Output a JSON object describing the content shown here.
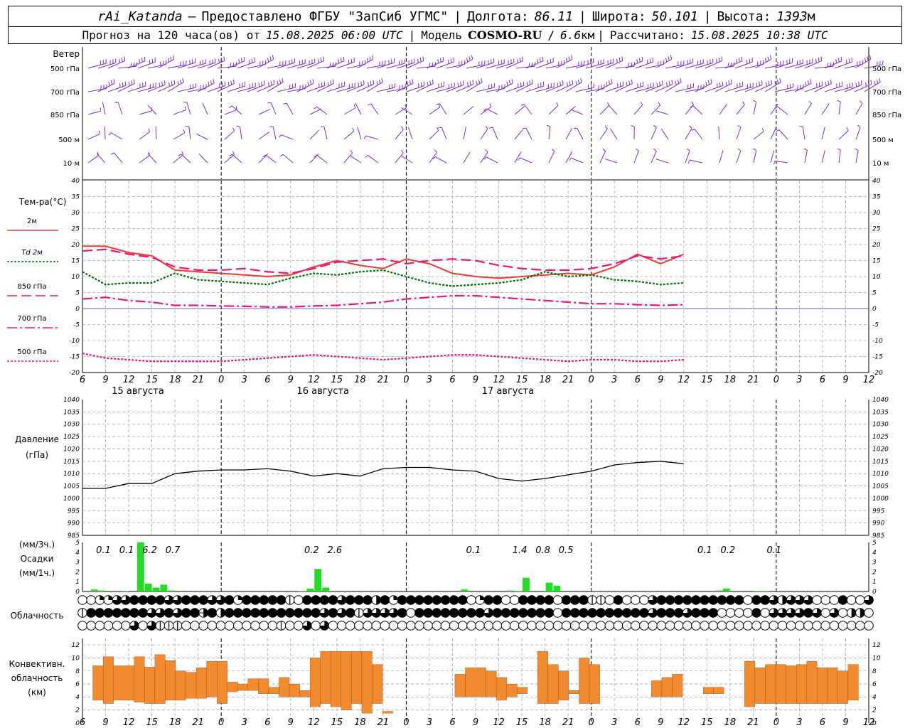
{
  "header": {
    "line1": {
      "station": "rAi_Katanda",
      "dash": "—",
      "provider": "Предоставлено ФГБУ \"ЗапСиб УГМС\"",
      "lon_label": "Долгота:",
      "lon_value": "86.11",
      "lat_label": "Широта:",
      "lat_value": "50.101",
      "alt_label": "Высота:",
      "alt_value": "1393",
      "alt_unit": "м"
    },
    "line2": {
      "forecast_label": "Прогноз на 120 часа(ов) от",
      "forecast_time": "15.08.2025 06:00 UTC",
      "model_label": "Модель",
      "model_name": "COSMO-RU",
      "model_res": "6.6",
      "model_res_unit": "км",
      "calc_label": "Рассчитано:",
      "calc_time": "15.08.2025 10:38 UTC"
    }
  },
  "chart_data": [
    {
      "type": "line",
      "panel": "wind",
      "title": "Ветер",
      "levels": [
        "500 гПа",
        "700 гПа",
        "850 гПа",
        "500 м",
        "10 м"
      ],
      "colors": {
        "barb": "#7b2fd0"
      }
    },
    {
      "type": "line",
      "panel": "temperature",
      "title": "Тем-ра(°C)",
      "ylim": [
        -20,
        40
      ],
      "yticks": [
        40,
        35,
        30,
        25,
        20,
        15,
        10,
        5,
        0,
        -5,
        -10,
        -15,
        -20
      ],
      "x_hours": [
        0,
        3,
        6,
        9,
        12,
        15,
        18,
        21,
        24,
        27,
        30,
        33,
        36,
        39,
        42,
        45,
        48,
        51,
        54,
        57,
        60,
        63,
        66,
        69,
        72,
        75,
        78
      ],
      "xtick_labels": [
        "6",
        "9",
        "12",
        "15",
        "18",
        "21",
        "0",
        "3",
        "6",
        "9",
        "12",
        "15",
        "18",
        "21",
        "0",
        "3",
        "6",
        "9",
        "12",
        "15",
        "18",
        "21",
        "0",
        "3",
        "6",
        "9",
        "12"
      ],
      "day_labels": [
        "15 августа",
        "16 августа",
        "17 августа"
      ],
      "series": [
        {
          "name": "2м",
          "color": "#ef3b2c",
          "dash": "solid",
          "values": [
            19.5,
            19.5,
            17.5,
            16.5,
            12.0,
            11.5,
            11.0,
            10.5,
            10.0,
            10.5,
            13.0,
            15.0,
            13.5,
            12.5,
            15.5,
            14.0,
            11.0,
            10.0,
            9.5,
            10.0,
            10.5,
            11.0,
            10.5,
            13.0,
            17.0,
            14.0,
            17.0
          ]
        },
        {
          "name": "Td 2м",
          "color": "#007000",
          "dash": "dot",
          "values": [
            11.5,
            7.5,
            8.0,
            8.0,
            11.0,
            9.0,
            8.5,
            8.0,
            7.5,
            9.5,
            11.0,
            10.5,
            11.5,
            12.0,
            10.0,
            8.0,
            7.0,
            7.5,
            8.0,
            9.0,
            11.5,
            10.0,
            10.5,
            9.0,
            8.5,
            7.5,
            8.0
          ]
        },
        {
          "name": "850 гПа",
          "color": "#e8177b",
          "dash": "longdash",
          "values": [
            18.0,
            18.5,
            17.0,
            16.0,
            13.0,
            12.0,
            12.0,
            12.5,
            11.5,
            11.0,
            12.5,
            14.5,
            15.0,
            15.5,
            14.0,
            15.0,
            15.5,
            15.0,
            13.5,
            12.5,
            12.0,
            12.0,
            12.5,
            14.0,
            16.5,
            15.5,
            16.5
          ]
        },
        {
          "name": "700 гПа",
          "color": "#e8177b",
          "dash": "dashdot",
          "values": [
            3.0,
            3.5,
            2.5,
            2.0,
            1.0,
            1.0,
            0.8,
            0.7,
            0.5,
            0.5,
            0.8,
            1.0,
            1.5,
            2.0,
            3.0,
            3.5,
            4.0,
            4.0,
            3.5,
            3.0,
            2.5,
            2.0,
            1.5,
            1.5,
            1.2,
            1.0,
            1.2
          ]
        },
        {
          "name": "500 гПа",
          "color": "#e8177b",
          "dash": "dot",
          "values": [
            -14.0,
            -15.5,
            -16.0,
            -16.5,
            -16.5,
            -16.5,
            -16.5,
            -16.0,
            -15.5,
            -15.0,
            -14.5,
            -15.0,
            -15.5,
            -16.0,
            -15.5,
            -15.0,
            -14.5,
            -14.5,
            -15.0,
            -15.5,
            -16.0,
            -16.5,
            -16.0,
            -16.0,
            -16.5,
            -16.5,
            -16.0
          ]
        }
      ]
    },
    {
      "type": "line",
      "panel": "pressure",
      "title": "Давление",
      "unit": "(гПа)",
      "ylim": [
        985,
        1040
      ],
      "yticks": [
        1040,
        1035,
        1030,
        1025,
        1020,
        1015,
        1010,
        1005,
        1000,
        995,
        990,
        985
      ],
      "series": [
        {
          "name": "Давление",
          "color": "#000000",
          "values": [
            1004.0,
            1004.0,
            1006.0,
            1006.0,
            1010.0,
            1011.0,
            1011.5,
            1011.5,
            1012.0,
            1011.0,
            1009.0,
            1010.0,
            1009.0,
            1012.0,
            1012.5,
            1012.5,
            1011.5,
            1011.0,
            1008.0,
            1007.0,
            1008.0,
            1009.5,
            1011.0,
            1013.5,
            1014.5,
            1015.0,
            1014.0
          ]
        }
      ]
    },
    {
      "type": "bar",
      "panel": "precipitation",
      "title": "Осадки",
      "labels": [
        "(мм/3ч.)",
        "(мм/1ч.)"
      ],
      "ylim": [
        0,
        5
      ],
      "yticks": [
        5,
        4,
        3,
        2,
        1,
        0
      ],
      "color": "#22dd22",
      "totals_3h": [
        {
          "hour": 3,
          "text": "0.1"
        },
        {
          "hour": 6,
          "text": "0.1"
        },
        {
          "hour": 9,
          "text": "6.2"
        },
        {
          "hour": 12,
          "text": "0.7"
        },
        {
          "hour": 30,
          "text": "0.2"
        },
        {
          "hour": 33,
          "text": "2.6"
        },
        {
          "hour": 51,
          "text": "0.1"
        },
        {
          "hour": 57,
          "text": "1.4"
        },
        {
          "hour": 60,
          "text": "0.8"
        },
        {
          "hour": 63,
          "text": "0.5"
        },
        {
          "hour": 81,
          "text": "0.1"
        },
        {
          "hour": 84,
          "text": "0.2"
        },
        {
          "hour": 90,
          "text": "0.1"
        }
      ],
      "bars_1h": [
        {
          "hour": 1,
          "value": 0.2
        },
        {
          "hour": 2,
          "value": 0.1
        },
        {
          "hour": 5,
          "value": 0.05
        },
        {
          "hour": 7,
          "value": 5.0
        },
        {
          "hour": 8,
          "value": 0.8
        },
        {
          "hour": 9,
          "value": 0.4
        },
        {
          "hour": 10,
          "value": 0.7
        },
        {
          "hour": 11,
          "value": 0.1
        },
        {
          "hour": 28,
          "value": 0.05
        },
        {
          "hour": 29,
          "value": 0.3
        },
        {
          "hour": 30,
          "value": 2.3
        },
        {
          "hour": 31,
          "value": 0.4
        },
        {
          "hour": 49,
          "value": 0.2
        },
        {
          "hour": 55,
          "value": 0.1
        },
        {
          "hour": 56,
          "value": 0.05
        },
        {
          "hour": 57,
          "value": 1.4
        },
        {
          "hour": 60,
          "value": 0.9
        },
        {
          "hour": 61,
          "value": 0.6
        },
        {
          "hour": 82,
          "value": 0.1
        },
        {
          "hour": 83,
          "value": 0.3
        },
        {
          "hour": 87,
          "value": 0.05
        },
        {
          "hour": 88,
          "value": 0.05
        }
      ]
    },
    {
      "type": "heatmap",
      "panel": "cloudiness",
      "title": "Облачность",
      "rows": [
        "00dd33444433444334d44444104444344424d444444440d4400444404441104000344444444440443233300040034440311000342444444",
        "14444444334344b42444444444443434133334044444444344444440444444444434443444000040333343030220444444444444444444",
        "000000303111000000000001003030000000000000000000000000000000000000000000000000000000000000000000000000300000"
      ]
    },
    {
      "type": "bar",
      "panel": "convective",
      "title": "Конвективн. облачность",
      "labels": [
        "Конвективн.",
        "облачность",
        "(км)"
      ],
      "ylim": [
        0,
        13
      ],
      "yticks": [
        12,
        10,
        8,
        6,
        4,
        2,
        0
      ],
      "color": "#f28a30",
      "bars": [
        {
          "h0": 1,
          "h1": 2,
          "base": 3.5,
          "top": 8.8
        },
        {
          "h0": 2,
          "h1": 3,
          "base": 3.0,
          "top": 10.2
        },
        {
          "h0": 3,
          "h1": 5,
          "base": 3.5,
          "top": 8.8
        },
        {
          "h0": 5,
          "h1": 6,
          "base": 3.2,
          "top": 10.2
        },
        {
          "h0": 6,
          "h1": 7,
          "base": 3.0,
          "top": 8.6
        },
        {
          "h0": 7,
          "h1": 8,
          "base": 3.0,
          "top": 10.5
        },
        {
          "h0": 8,
          "h1": 9,
          "base": 3.5,
          "top": 9.6
        },
        {
          "h0": 9,
          "h1": 10,
          "base": 3.5,
          "top": 8.0
        },
        {
          "h0": 10,
          "h1": 11,
          "base": 3.8,
          "top": 7.8
        },
        {
          "h0": 11,
          "h1": 12,
          "base": 3.8,
          "top": 8.5
        },
        {
          "h0": 12,
          "h1": 13,
          "base": 4.0,
          "top": 9.5
        },
        {
          "h0": 13,
          "h1": 14,
          "base": 3.0,
          "top": 9.5
        },
        {
          "h0": 14,
          "h1": 15,
          "base": 4.8,
          "top": 6.3
        },
        {
          "h0": 15,
          "h1": 16,
          "base": 5.0,
          "top": 6.0
        },
        {
          "h0": 16,
          "h1": 17,
          "base": 5.0,
          "top": 6.8
        },
        {
          "h0": 17,
          "h1": 18,
          "base": 4.5,
          "top": 6.8
        },
        {
          "h0": 18,
          "h1": 19,
          "base": 4.5,
          "top": 5.5
        },
        {
          "h0": 19,
          "h1": 20,
          "base": 4.0,
          "top": 7.0
        },
        {
          "h0": 20,
          "h1": 21,
          "base": 4.0,
          "top": 6.0
        },
        {
          "h0": 21,
          "h1": 22,
          "base": 4.0,
          "top": 5.0
        },
        {
          "h0": 22,
          "h1": 23,
          "base": 2.5,
          "top": 10.0
        },
        {
          "h0": 23,
          "h1": 24,
          "base": 3.0,
          "top": 11.0
        },
        {
          "h0": 24,
          "h1": 25,
          "base": 2.5,
          "top": 11.0
        },
        {
          "h0": 25,
          "h1": 26,
          "base": 2.0,
          "top": 11.0
        },
        {
          "h0": 26,
          "h1": 27,
          "base": 3.0,
          "top": 11.0
        },
        {
          "h0": 27,
          "h1": 28,
          "base": 1.5,
          "top": 11.0
        },
        {
          "h0": 28,
          "h1": 29,
          "base": 3.0,
          "top": 9.0
        },
        {
          "h0": 29,
          "h1": 30,
          "base": 1.5,
          "top": 1.8
        },
        {
          "h0": 36,
          "h1": 37,
          "base": 4.0,
          "top": 7.5
        },
        {
          "h0": 37,
          "h1": 39,
          "base": 4.0,
          "top": 8.5
        },
        {
          "h0": 39,
          "h1": 40,
          "base": 4.0,
          "top": 8.0
        },
        {
          "h0": 40,
          "h1": 41,
          "base": 3.5,
          "top": 7.0
        },
        {
          "h0": 41,
          "h1": 42,
          "base": 4.0,
          "top": 6.0
        },
        {
          "h0": 42,
          "h1": 43,
          "base": 4.5,
          "top": 5.5
        },
        {
          "h0": 44,
          "h1": 45,
          "base": 3.0,
          "top": 11.0
        },
        {
          "h0": 45,
          "h1": 46,
          "base": 3.0,
          "top": 9.0
        },
        {
          "h0": 46,
          "h1": 47,
          "base": 3.5,
          "top": 8.0
        },
        {
          "h0": 47,
          "h1": 48,
          "base": 4.5,
          "top": 5.0
        },
        {
          "h0": 48,
          "h1": 49,
          "base": 3.0,
          "top": 10.0
        },
        {
          "h0": 49,
          "h1": 50,
          "base": 3.0,
          "top": 9.0
        },
        {
          "h0": 55,
          "h1": 56,
          "base": 4.0,
          "top": 6.5
        },
        {
          "h0": 56,
          "h1": 57,
          "base": 4.0,
          "top": 7.0
        },
        {
          "h0": 57,
          "h1": 58,
          "base": 4.0,
          "top": 7.5
        },
        {
          "h0": 60,
          "h1": 61,
          "base": 4.5,
          "top": 5.5
        },
        {
          "h0": 61,
          "h1": 62,
          "base": 4.5,
          "top": 5.5
        },
        {
          "h0": 64,
          "h1": 65,
          "base": 2.5,
          "top": 9.5
        },
        {
          "h0": 65,
          "h1": 66,
          "base": 3.0,
          "top": 8.5
        },
        {
          "h0": 66,
          "h1": 67,
          "base": 3.0,
          "top": 9.0
        },
        {
          "h0": 67,
          "h1": 68,
          "base": 3.0,
          "top": 9.0
        },
        {
          "h0": 68,
          "h1": 69,
          "base": 3.0,
          "top": 8.8
        },
        {
          "h0": 69,
          "h1": 70,
          "base": 3.0,
          "top": 9.0
        },
        {
          "h0": 70,
          "h1": 71,
          "base": 3.0,
          "top": 9.5
        },
        {
          "h0": 71,
          "h1": 72,
          "base": 3.0,
          "top": 8.5
        },
        {
          "h0": 72,
          "h1": 73,
          "base": 3.0,
          "top": 8.5
        },
        {
          "h0": 73,
          "h1": 74,
          "base": 3.0,
          "top": 8.0
        },
        {
          "h0": 74,
          "h1": 75,
          "base": 3.5,
          "top": 9.0
        }
      ]
    }
  ]
}
